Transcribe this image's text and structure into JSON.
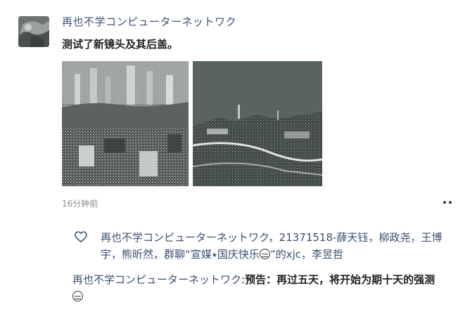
{
  "post": {
    "author": "再也不学コンピューターネットワク",
    "content": "测试了新镜头及其后盖。",
    "time": "16分钟前",
    "images": [
      {
        "icon": "city-photo-day"
      },
      {
        "icon": "city-photo-night"
      }
    ]
  },
  "likes": {
    "icon": "heart-outline-icon",
    "names": [
      "再也不学コンピューターネットワク",
      "21371518-薛天钰",
      "柳政尧",
      "王博宇",
      "熊昕然",
      "群聊“宣媒⭑国庆快乐",
      "”的xjc",
      "李昱哲"
    ],
    "separator": "，"
  },
  "comment": {
    "author": "再也不学コンピューターネットワク",
    "separator": ":",
    "text": "预告：再过五天，将开始为期十天的强测"
  },
  "colors": {
    "name_blue": "#3b4f73",
    "photo_day_bg": "#7d8282",
    "photo_night_bg": "#5b6262"
  }
}
